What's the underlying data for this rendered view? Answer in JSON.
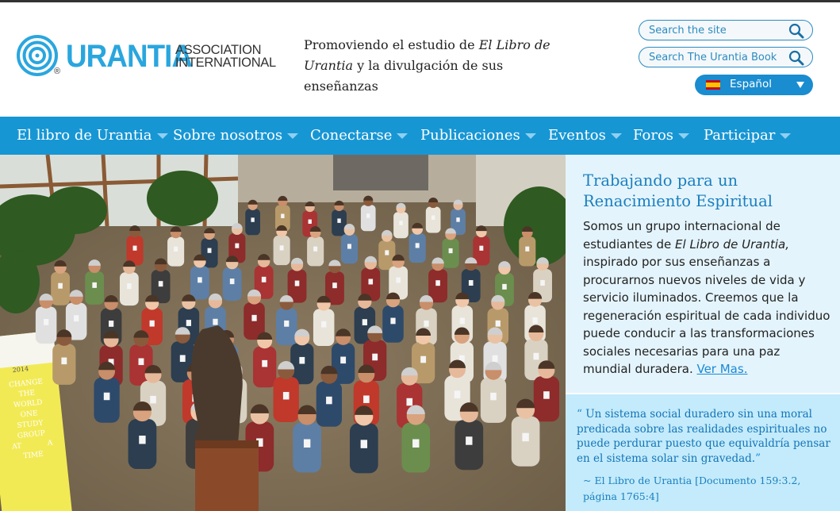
{
  "header": {
    "logo_word": "URANTIA",
    "logo_registered": "®",
    "logo_subtitle_line1": "ASSOCIATION",
    "logo_subtitle_line2": "INTERNATIONAL",
    "tagline_part1": "Promoviendo el estudio de ",
    "tagline_book": "El Libro de Urantia",
    "tagline_part2": " y la divulgación de sus enseñanzas",
    "search_site_placeholder": "Search the site",
    "search_book_placeholder": "Search The Urantia Book",
    "language": "Español",
    "brand_color": "#2aa6de"
  },
  "nav": {
    "items": [
      {
        "label": "El libro de Urantia"
      },
      {
        "label": "Sobre nosotros"
      },
      {
        "label": "Conectarse"
      },
      {
        "label": "Publicaciones"
      },
      {
        "label": "Eventos"
      },
      {
        "label": "Foros"
      },
      {
        "label": "Participar"
      }
    ],
    "color": "#1796d4"
  },
  "intro": {
    "heading": "Trabajando para un Renacimiento Espiritual",
    "body_part1": "Somos un grupo internacional de estudiantes de ",
    "body_book": "El Libro de Urantia,",
    "body_part2": " inspirado por sus enseñanzas a procurarnos nuevos niveles de vida y servicio iluminados. Creemos que la regeneración espiritual de cada individuo puede conducir a las transformaciones sociales necesarias para una paz mundial duradera. ",
    "more_link": "Ver Mas."
  },
  "quote": {
    "open_mark": "“",
    "text": " Un sistema social duradero sin una moral predicada sobre las realidades espirituales no puede perdurar puesto que equivaldría pensar en el sistema solar sin gravedad.",
    "close_mark": "”",
    "source": "~ El Libro de Urantia [Documento 159:3.2, página 1765:4]"
  },
  "hero": {
    "banner_text": "CHANGE THE WORLD ONE STUDY GROUP AT A TIME",
    "banner_year": "2014"
  }
}
